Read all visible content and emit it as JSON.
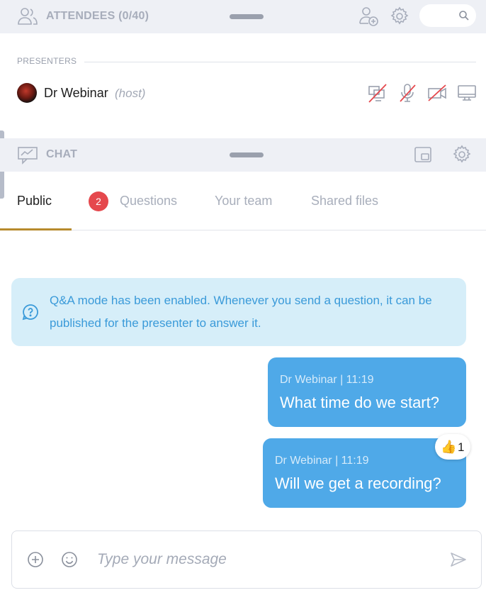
{
  "attendees_bar": {
    "title": "ATTENDEES (0/40)",
    "icons": [
      "attendees-icon",
      "add-user-icon",
      "gear-icon",
      "search-icon"
    ],
    "search_placeholder": ""
  },
  "presenters": {
    "section_label": "PRESENTERS",
    "items": [
      {
        "name": "Dr Webinar",
        "role": "(host)",
        "controls": [
          "screen-share-off-icon",
          "microphone-off-icon",
          "camera-off-icon",
          "monitor-icon"
        ]
      }
    ]
  },
  "chat_bar": {
    "title": "CHAT",
    "icons": [
      "chat-icon",
      "popout-icon",
      "gear-icon"
    ]
  },
  "tabs": {
    "items": [
      {
        "label": "Public",
        "active": true
      },
      {
        "label": "Questions",
        "badge": "2"
      },
      {
        "label": "Your team"
      },
      {
        "label": "Shared files"
      }
    ]
  },
  "info_banner": {
    "icon": "question-icon",
    "text": "Q&A mode has been enabled. Whenever you send a question, it can be published for the presenter to answer it."
  },
  "messages": [
    {
      "author": "Dr Webinar",
      "time": "11:19",
      "meta": "Dr Webinar  |  11:19",
      "text": "What time do we start?"
    },
    {
      "author": "Dr Webinar",
      "time": "11:19",
      "meta": "Dr Webinar  |  11:19",
      "text": "Will we get a recording?",
      "reaction": {
        "emoji": "thumbs-up",
        "glyph": "👍",
        "count": "1"
      }
    }
  ],
  "composer": {
    "placeholder": "Type your message",
    "value": "",
    "icons": [
      "add-icon",
      "emoji-icon",
      "send-icon"
    ]
  },
  "colors": {
    "accent_tab": "#b78a2d",
    "message_bubble": "#4fa9e8",
    "info_background": "#d6eef9",
    "badge": "#e5484d",
    "bar_background": "#eef0f5"
  }
}
